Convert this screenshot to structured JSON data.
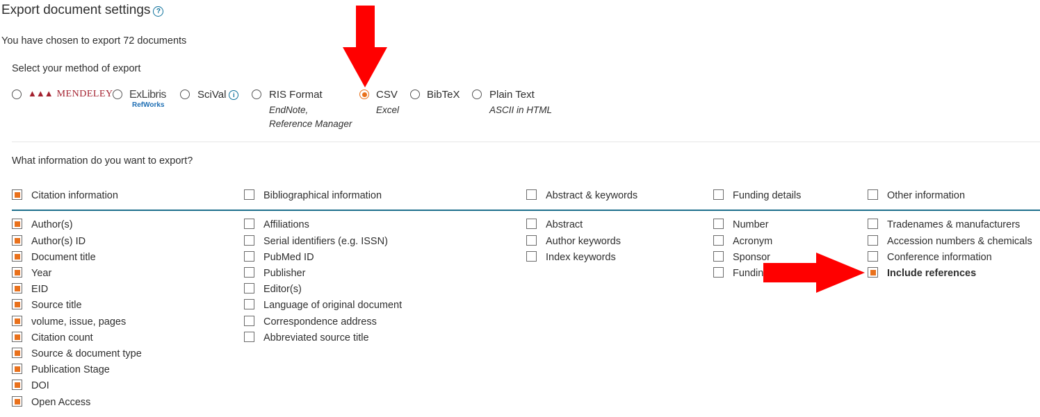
{
  "header": {
    "title": "Export document settings",
    "help_icon": "question-circle-icon",
    "chosen_text": "You have chosen to export 72 documents"
  },
  "method": {
    "heading": "Select your method of export",
    "options": [
      {
        "label": "MENDELEY",
        "selected": false,
        "sublines": []
      },
      {
        "label": "ExLibris",
        "sublabel": "RefWorks",
        "selected": false,
        "sublines": []
      },
      {
        "label": "SciVal",
        "selected": false,
        "sublines": []
      },
      {
        "label": "RIS Format",
        "selected": false,
        "sublines": [
          "EndNote,",
          "Reference Manager"
        ]
      },
      {
        "label": "CSV",
        "selected": true,
        "sublines": [
          "Excel"
        ]
      },
      {
        "label": "BibTeX",
        "selected": false,
        "sublines": []
      },
      {
        "label": "Plain Text",
        "selected": false,
        "sublines": [
          "ASCII in HTML"
        ]
      }
    ]
  },
  "info": {
    "heading": "What information do you want to export?",
    "columns": [
      {
        "header": "Citation information",
        "header_checked": true,
        "items": [
          {
            "label": "Author(s)",
            "checked": true
          },
          {
            "label": "Author(s) ID",
            "checked": true
          },
          {
            "label": "Document title",
            "checked": true
          },
          {
            "label": "Year",
            "checked": true
          },
          {
            "label": "EID",
            "checked": true
          },
          {
            "label": "Source title",
            "checked": true
          },
          {
            "label": "volume, issue, pages",
            "checked": true
          },
          {
            "label": "Citation count",
            "checked": true
          },
          {
            "label": "Source & document type",
            "checked": true
          },
          {
            "label": "Publication Stage",
            "checked": true
          },
          {
            "label": "DOI",
            "checked": true
          },
          {
            "label": "Open Access",
            "checked": true
          }
        ]
      },
      {
        "header": "Bibliographical information",
        "header_checked": false,
        "items": [
          {
            "label": "Affiliations",
            "checked": false
          },
          {
            "label": "Serial identifiers (e.g. ISSN)",
            "checked": false
          },
          {
            "label": "PubMed ID",
            "checked": false
          },
          {
            "label": "Publisher",
            "checked": false
          },
          {
            "label": "Editor(s)",
            "checked": false
          },
          {
            "label": "Language of original document",
            "checked": false
          },
          {
            "label": "Correspondence address",
            "checked": false
          },
          {
            "label": "Abbreviated source title",
            "checked": false
          }
        ]
      },
      {
        "header": "Abstract & keywords",
        "header_checked": false,
        "items": [
          {
            "label": "Abstract",
            "checked": false
          },
          {
            "label": "Author keywords",
            "checked": false
          },
          {
            "label": "Index keywords",
            "checked": false
          }
        ]
      },
      {
        "header": "Funding details",
        "header_checked": false,
        "items": [
          {
            "label": "Number",
            "checked": false
          },
          {
            "label": "Acronym",
            "checked": false
          },
          {
            "label": "Sponsor",
            "checked": false
          },
          {
            "label": "Fundin",
            "checked": false
          }
        ]
      },
      {
        "header": "Other information",
        "header_checked": false,
        "items": [
          {
            "label": "Tradenames & manufacturers",
            "checked": false
          },
          {
            "label": "Accession numbers & chemicals",
            "checked": false
          },
          {
            "label": "Conference information",
            "checked": false
          },
          {
            "label": "Include references",
            "checked": true
          }
        ]
      }
    ]
  },
  "annotations": {
    "color": "#ff0000",
    "arrows": [
      "down-arrow-to-csv",
      "left-arrow-to-include-references"
    ]
  },
  "colors": {
    "accent": "#e9711c",
    "link": "#0a6f9a",
    "divider": "#1d6f8c"
  }
}
